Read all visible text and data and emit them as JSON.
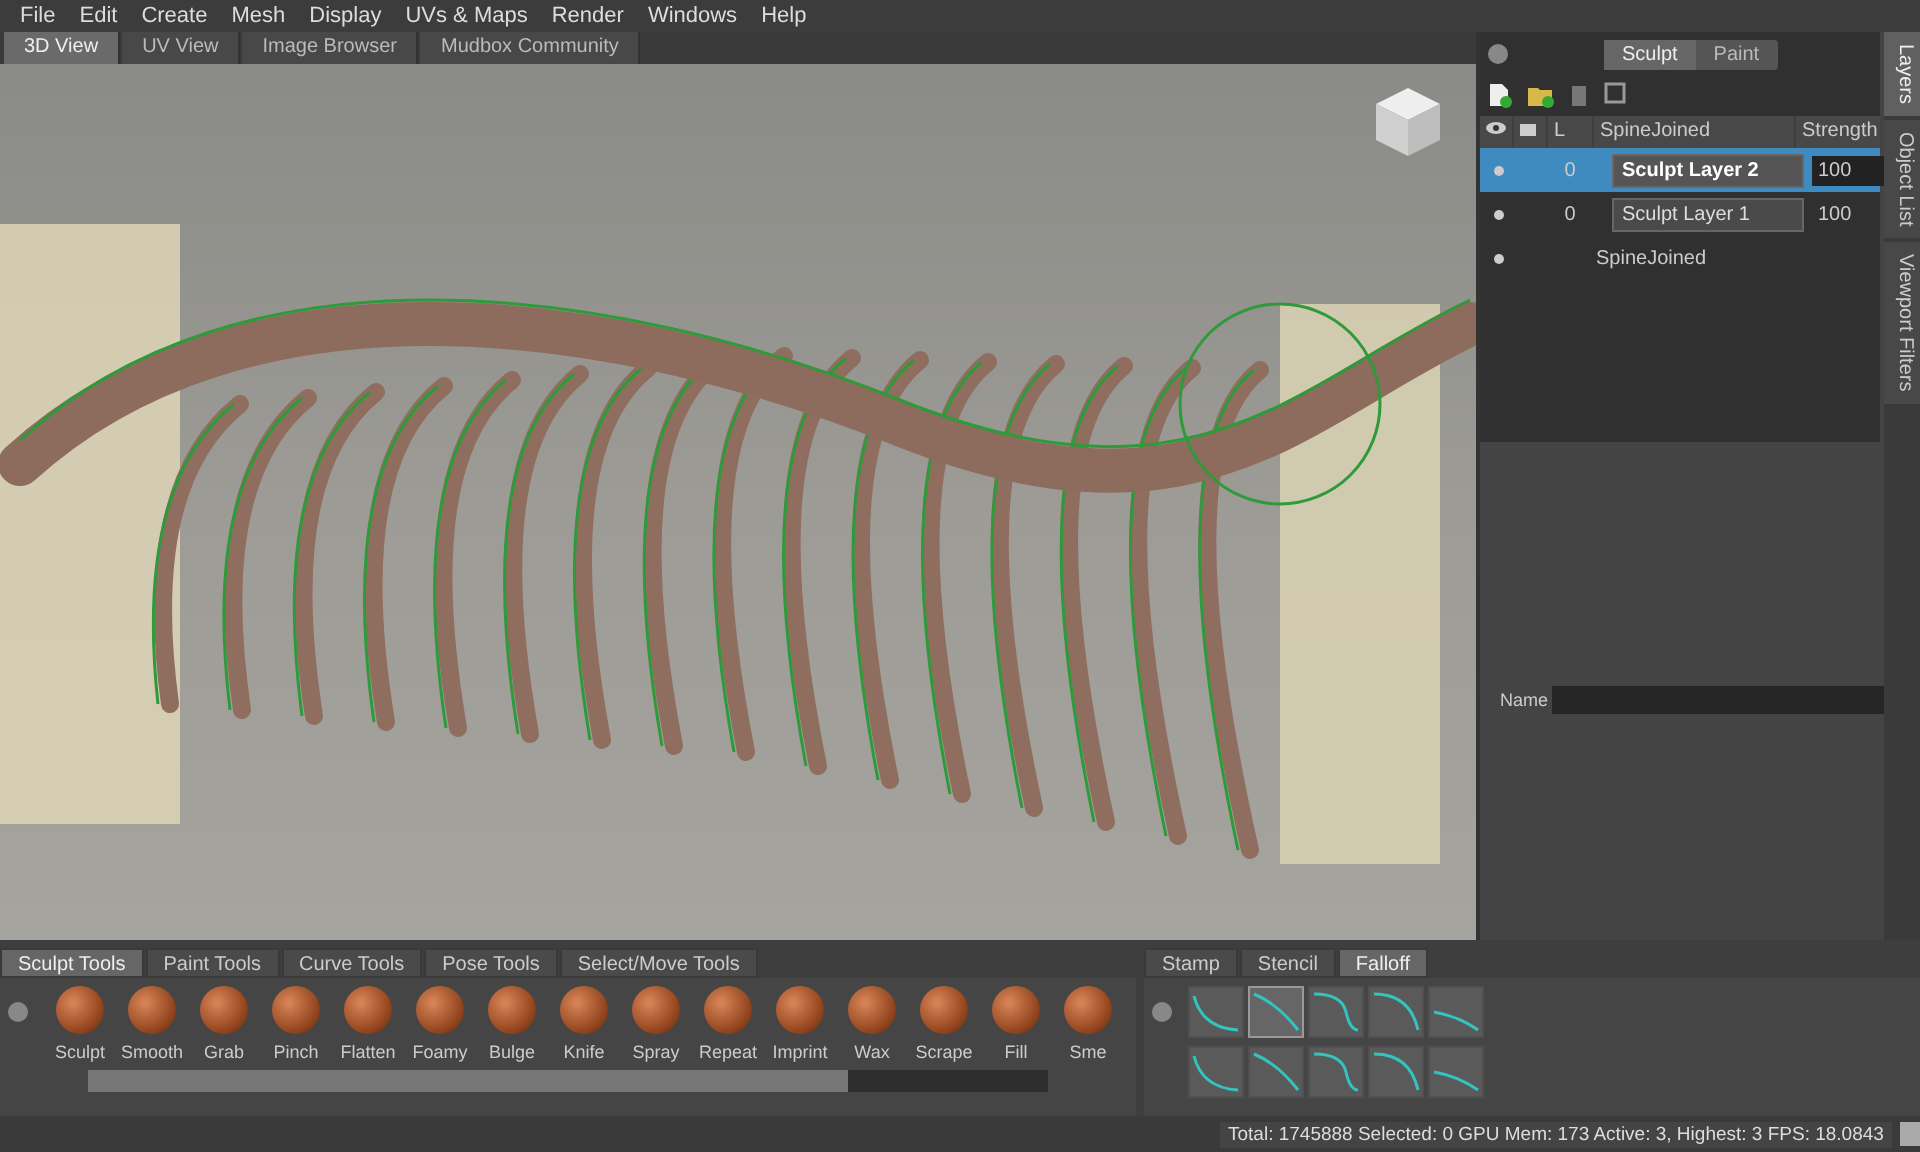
{
  "menu": [
    "File",
    "Edit",
    "Create",
    "Mesh",
    "Display",
    "UVs & Maps",
    "Render",
    "Windows",
    "Help"
  ],
  "view_tabs": [
    {
      "label": "3D View",
      "selected": true
    },
    {
      "label": "UV View",
      "selected": false
    },
    {
      "label": "Image Browser",
      "selected": false
    },
    {
      "label": "Mudbox Community",
      "selected": false
    }
  ],
  "layers_panel": {
    "mode_tabs": [
      {
        "label": "Sculpt",
        "selected": true
      },
      {
        "label": "Paint",
        "selected": false
      }
    ],
    "columns": [
      "L",
      "SpineJoined",
      "Strength"
    ],
    "rows": [
      {
        "kind": "layer",
        "visible": true,
        "locked_level": "0",
        "name": "Sculpt Layer 2",
        "strength": "100",
        "selected": true
      },
      {
        "kind": "layer",
        "visible": true,
        "locked_level": "0",
        "name": "Sculpt Layer 1",
        "strength": "100",
        "selected": false
      },
      {
        "kind": "mesh",
        "visible": true,
        "name": "SpineJoined",
        "selected": false
      }
    ],
    "side_tabs": [
      {
        "label": "Layers",
        "selected": true
      },
      {
        "label": "Object List",
        "selected": false
      },
      {
        "label": "Viewport Filters",
        "selected": false
      }
    ],
    "name_field": {
      "label": "Name"
    }
  },
  "tool_tabs": [
    {
      "label": "Sculpt Tools",
      "selected": true
    },
    {
      "label": "Paint Tools",
      "selected": false
    },
    {
      "label": "Curve Tools",
      "selected": false
    },
    {
      "label": "Pose Tools",
      "selected": false
    },
    {
      "label": "Select/Move Tools",
      "selected": false
    }
  ],
  "tools": [
    "Sculpt",
    "Smooth",
    "Grab",
    "Pinch",
    "Flatten",
    "Foamy",
    "Bulge",
    "Knife",
    "Spray",
    "Repeat",
    "Imprint",
    "Wax",
    "Scrape",
    "Fill",
    "Sme"
  ],
  "tray_tabs": [
    {
      "label": "Stamp",
      "selected": false
    },
    {
      "label": "Stencil",
      "selected": false
    },
    {
      "label": "Falloff",
      "selected": true
    }
  ],
  "falloffs": [
    {
      "selected": false
    },
    {
      "selected": true
    },
    {
      "selected": false
    },
    {
      "selected": false
    },
    {
      "selected": false
    },
    {
      "selected": false
    },
    {
      "selected": false
    },
    {
      "selected": false
    },
    {
      "selected": false
    },
    {
      "selected": false
    }
  ],
  "status_bar": "Total: 1745888  Selected: 0 GPU Mem: 173  Active: 3, Highest: 3  FPS: 18.0843"
}
